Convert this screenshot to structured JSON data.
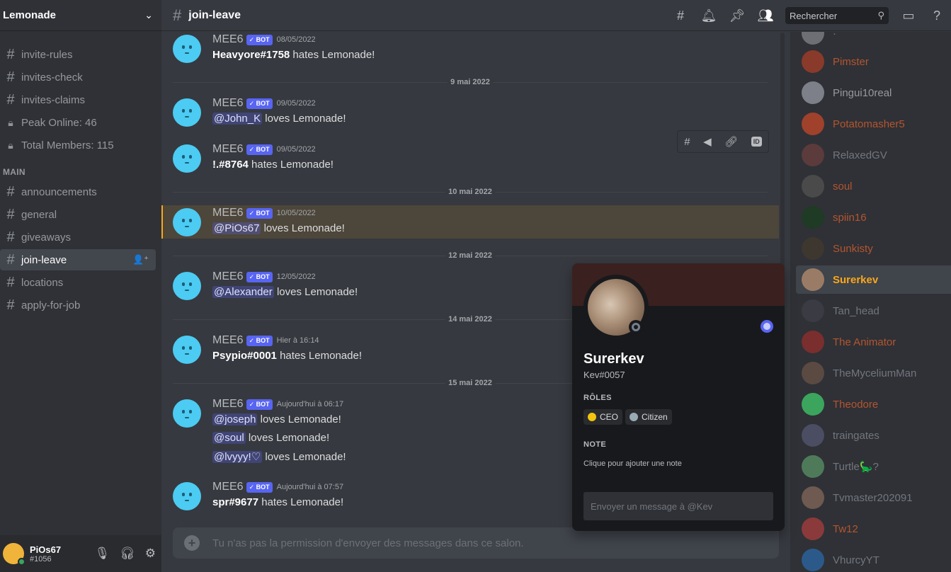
{
  "server": {
    "name": "Lemonade"
  },
  "channels_top": [
    {
      "label": "invite-rules",
      "glyph": "#"
    },
    {
      "label": "invites-check",
      "glyph": "#"
    },
    {
      "label": "invites-claims",
      "glyph": "#"
    },
    {
      "label": "Peak Online: 46",
      "glyph": "lock"
    },
    {
      "label": "Total Members: 115",
      "glyph": "lock"
    }
  ],
  "category": "MAIN",
  "channels_main": [
    {
      "label": "announcements"
    },
    {
      "label": "general"
    },
    {
      "label": "giveaways"
    },
    {
      "label": "join-leave"
    },
    {
      "label": "locations"
    },
    {
      "label": "apply-for-job"
    }
  ],
  "user": {
    "name": "PiOs67",
    "tag": "#1056"
  },
  "header": {
    "channel": "join-leave",
    "search_placeholder": "Rechercher"
  },
  "bot_badge": "✓ BOT",
  "messages": [
    {
      "author": "MEE6",
      "time": "08/05/2022",
      "lines": [
        {
          "who": "Heavyore#1758",
          "text": " hates Lemonade!"
        }
      ]
    },
    {
      "author": "MEE6",
      "time": "09/05/2022",
      "lines": [
        {
          "mention": "@John_K",
          "text": " loves Lemonade!"
        }
      ]
    },
    {
      "author": "MEE6",
      "time": "09/05/2022",
      "lines": [
        {
          "who": "!.#8764",
          "text": " hates Lemonade!"
        }
      ]
    },
    {
      "author": "MEE6",
      "time": "10/05/2022",
      "lines": [
        {
          "mention": "@PiOs67",
          "text": " loves Lemonade!"
        }
      ]
    },
    {
      "author": "MEE6",
      "time": "12/05/2022",
      "lines": [
        {
          "mention": "@Alexander",
          "text": " loves Lemonade!"
        }
      ]
    },
    {
      "author": "MEE6",
      "time": "Hier à 16:14",
      "lines": [
        {
          "who": "Psypio#0001",
          "text": " hates Lemonade!"
        }
      ]
    },
    {
      "author": "MEE6",
      "time": "Aujourd'hui à 06:17",
      "lines": [
        {
          "mention": "@joseph",
          "text": " loves Lemonade!"
        },
        {
          "mention": "@soul",
          "text": " loves Lemonade!"
        },
        {
          "mention": "@lvyyy!♡",
          "text": " loves Lemonade!"
        }
      ]
    },
    {
      "author": "MEE6",
      "time": "Aujourd'hui à 07:57",
      "lines": [
        {
          "who": "spr#9677",
          "text": " hates Lemonade!"
        }
      ]
    }
  ],
  "dividers": [
    "9 mai 2022",
    "10 mai 2022",
    "12 mai 2022",
    "14 mai 2022",
    "15 mai 2022"
  ],
  "composer": {
    "placeholder": "Tu n'as pas la permission d'envoyer des messages dans ce salon."
  },
  "members": [
    {
      "name": "Pimster",
      "color": "#b4552f",
      "avatar": "#8a3a2a"
    },
    {
      "name": "Pingui10real",
      "color": "#96989d",
      "avatar": "#7d8088"
    },
    {
      "name": "Potatomasher5",
      "color": "#b4552f",
      "avatar": "#a0412c"
    },
    {
      "name": "RelaxedGV",
      "color": "#72767d",
      "avatar": "#5b3b3b"
    },
    {
      "name": "soul",
      "color": "#b4552f",
      "avatar": "#4a4a4a"
    },
    {
      "name": "spiin16",
      "color": "#b4552f",
      "avatar": "#1f3a25"
    },
    {
      "name": "Sunkisty",
      "color": "#b4552f",
      "avatar": "#3d3730"
    },
    {
      "name": "Surerkev",
      "color": "#faa81a",
      "avatar": "#9a7c66"
    },
    {
      "name": "Tan_head",
      "color": "#72767d",
      "avatar": "#3b3b44"
    },
    {
      "name": "The Animator",
      "color": "#b4552f",
      "avatar": "#7a2e2e"
    },
    {
      "name": "TheMyceliumMan",
      "color": "#72767d",
      "avatar": "#5a4a42"
    },
    {
      "name": "Theodore",
      "color": "#b4552f",
      "avatar": "#3ba55d"
    },
    {
      "name": "traingates",
      "color": "#72767d",
      "avatar": "#4b4d63"
    },
    {
      "name": "Turtle🦕?",
      "color": "#72767d",
      "avatar": "#4e7a5a"
    },
    {
      "name": "Tvmaster202091",
      "color": "#72767d",
      "avatar": "#6e5a50"
    },
    {
      "name": "Tw12",
      "color": "#b4552f",
      "avatar": "#8a3a3a"
    },
    {
      "name": "VhurcyYT",
      "color": "#72767d",
      "avatar": "#2b5a8a"
    }
  ],
  "popout": {
    "name": "Surerkev",
    "tag": "Kev#0057",
    "roles_title": "RÔLES",
    "roles": [
      {
        "label": "CEO",
        "color": "#f1c40f"
      },
      {
        "label": "Citizen",
        "color": "#99aab5"
      }
    ],
    "note_title": "NOTE",
    "note_placeholder": "Clique pour ajouter une note",
    "message_placeholder": "Envoyer un message à @Kev"
  }
}
